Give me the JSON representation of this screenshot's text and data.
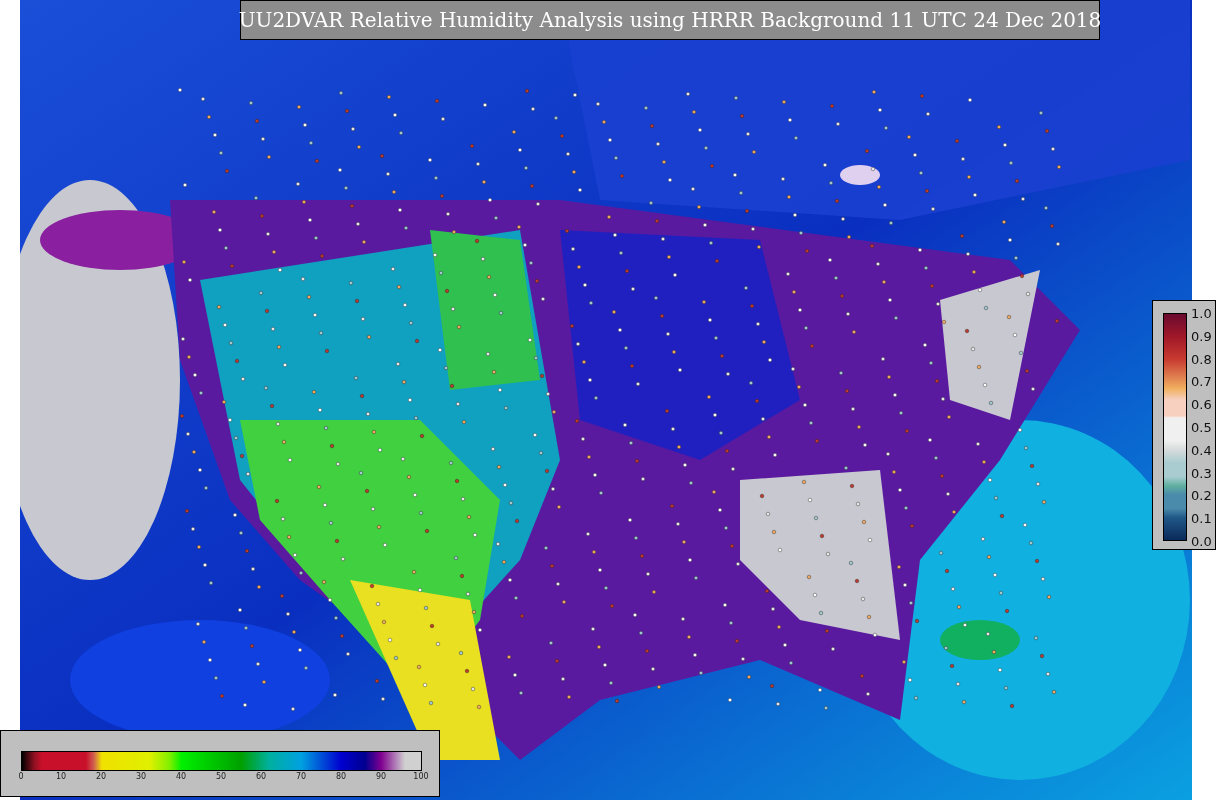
{
  "title": "UU2DVAR Relative Humidity Analysis using HRRR Background 11 UTC 24 Dec 2018",
  "humidity_colorbar": {
    "ticks": [
      "0",
      "10",
      "20",
      "30",
      "40",
      "50",
      "60",
      "70",
      "80",
      "90",
      "100"
    ]
  },
  "station_colorbar": {
    "ticks": [
      "1.0",
      "0.9",
      "0.8",
      "0.7",
      "0.6",
      "0.5",
      "0.4",
      "0.3",
      "0.2",
      "0.1",
      "0.0"
    ]
  }
}
